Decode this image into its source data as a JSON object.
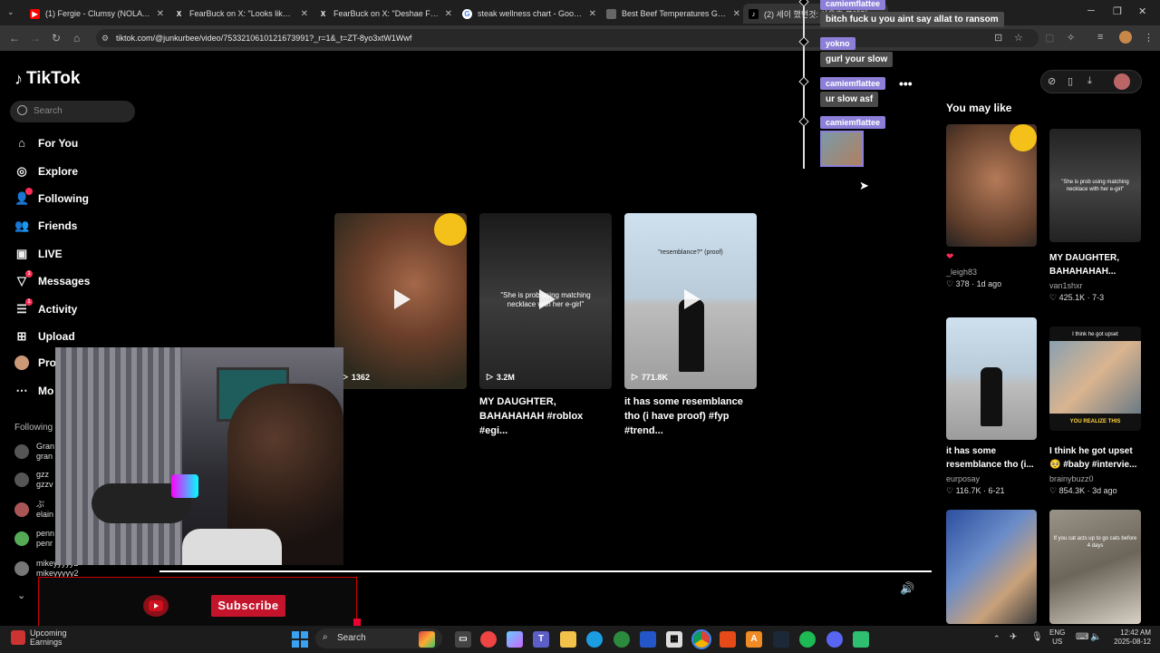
{
  "browser": {
    "tabs": [
      {
        "title": "(1) Fergie - Clumsy (NOLA BOU",
        "favicon": "youtube-icon"
      },
      {
        "title": "FearBuck on X: \"Looks like the",
        "favicon": "x-icon"
      },
      {
        "title": "FearBuck on X: \"Deshae Frost",
        "favicon": "x-icon"
      },
      {
        "title": "steak wellness chart - Google S",
        "favicon": "google-icon"
      },
      {
        "title": "Best Beef Temperatures Guide",
        "favicon": "page-icon"
      },
      {
        "title": "(2) 세이 했던것: 사우호 프레임",
        "favicon": "tiktok-icon"
      }
    ],
    "url": "tiktok.com/@junkurbee/video/7533210610121673991?_r=1&_t=ZT-8yo3xtW1Wwf"
  },
  "tiktok": {
    "logo": "TikTok",
    "search_placeholder": "Search",
    "menu": [
      {
        "label": "For You",
        "icon": "home-icon"
      },
      {
        "label": "Explore",
        "icon": "compass-icon"
      },
      {
        "label": "Following",
        "icon": "following-icon"
      },
      {
        "label": "Friends",
        "icon": "friends-icon"
      },
      {
        "label": "LIVE",
        "icon": "live-icon"
      },
      {
        "label": "Messages",
        "icon": "messages-icon",
        "badge": "1"
      },
      {
        "label": "Activity",
        "icon": "activity-icon",
        "badge": "1"
      },
      {
        "label": "Upload",
        "icon": "upload-icon"
      },
      {
        "label": "Pro",
        "icon": "profile-avatar"
      },
      {
        "label": "Mo",
        "icon": "more-icon"
      }
    ],
    "following_header": "Following",
    "following": [
      {
        "name": "Gran",
        "handle": "gran"
      },
      {
        "name": "gzz",
        "handle": "gzzv"
      },
      {
        "name": "ぷ",
        "handle": "elain"
      },
      {
        "name": "penn",
        "handle": "penr"
      },
      {
        "name": "mikeyyyyy2",
        "handle": "mikeyyyyy2"
      }
    ],
    "videos": [
      {
        "views": "1362",
        "title": ""
      },
      {
        "views": "3.2M",
        "title": "MY DAUGHTER, BAHAHAHAH #roblox #egi...",
        "overlay": "\"She is prob using matching necklace with her e-girl\""
      },
      {
        "views": "771.8K",
        "title": "it has some resemblance tho (i have proof) #fyp #trend...",
        "overlay": "\"resemblance?\" (proof)"
      }
    ],
    "you_may_like": "You may like",
    "recs": [
      {
        "caption": "",
        "user": "_leigh83",
        "likes": "378",
        "age": "1d ago"
      },
      {
        "caption": "MY DAUGHTER, BAHAHAHAH...",
        "user": "van1shxr",
        "likes": "425.1K",
        "age": "7-3",
        "overlay": "\"She is prob using matching necklace with her e-girl\""
      },
      {
        "caption": "it has some resemblance tho (i...",
        "user": "eurposay",
        "likes": "116.7K",
        "age": "6-21"
      },
      {
        "caption": "I think he got upset 🥺 #baby #intervie...",
        "user": "brainybuzz0",
        "likes": "854.3K",
        "age": "3d ago",
        "top_text": "I think he got upset",
        "bottom_text": "YOU REALIZE THIS"
      },
      {
        "caption": "",
        "user": "",
        "likes": "",
        "age": ""
      },
      {
        "caption": "",
        "user": "",
        "likes": "",
        "age": "",
        "overlay": "If you cat acts up to go cats before 4 days"
      }
    ]
  },
  "chat": [
    {
      "user": "camiemflattee",
      "message": "bitch fuck u you aint say allat to ransom"
    },
    {
      "user": "yokno",
      "message": "gurl your slow"
    },
    {
      "user": "camiemflattee",
      "message": "ur slow asf"
    },
    {
      "user": "camiemflattee",
      "message": ""
    }
  ],
  "stream": {
    "subscribe_label": "Subscribe"
  },
  "taskbar": {
    "weather_title": "Upcoming",
    "weather_sub": "Earnings",
    "search": "Search",
    "lang": "ENG",
    "region": "US",
    "time": "12:42 AM",
    "date": "2025-08-12"
  }
}
